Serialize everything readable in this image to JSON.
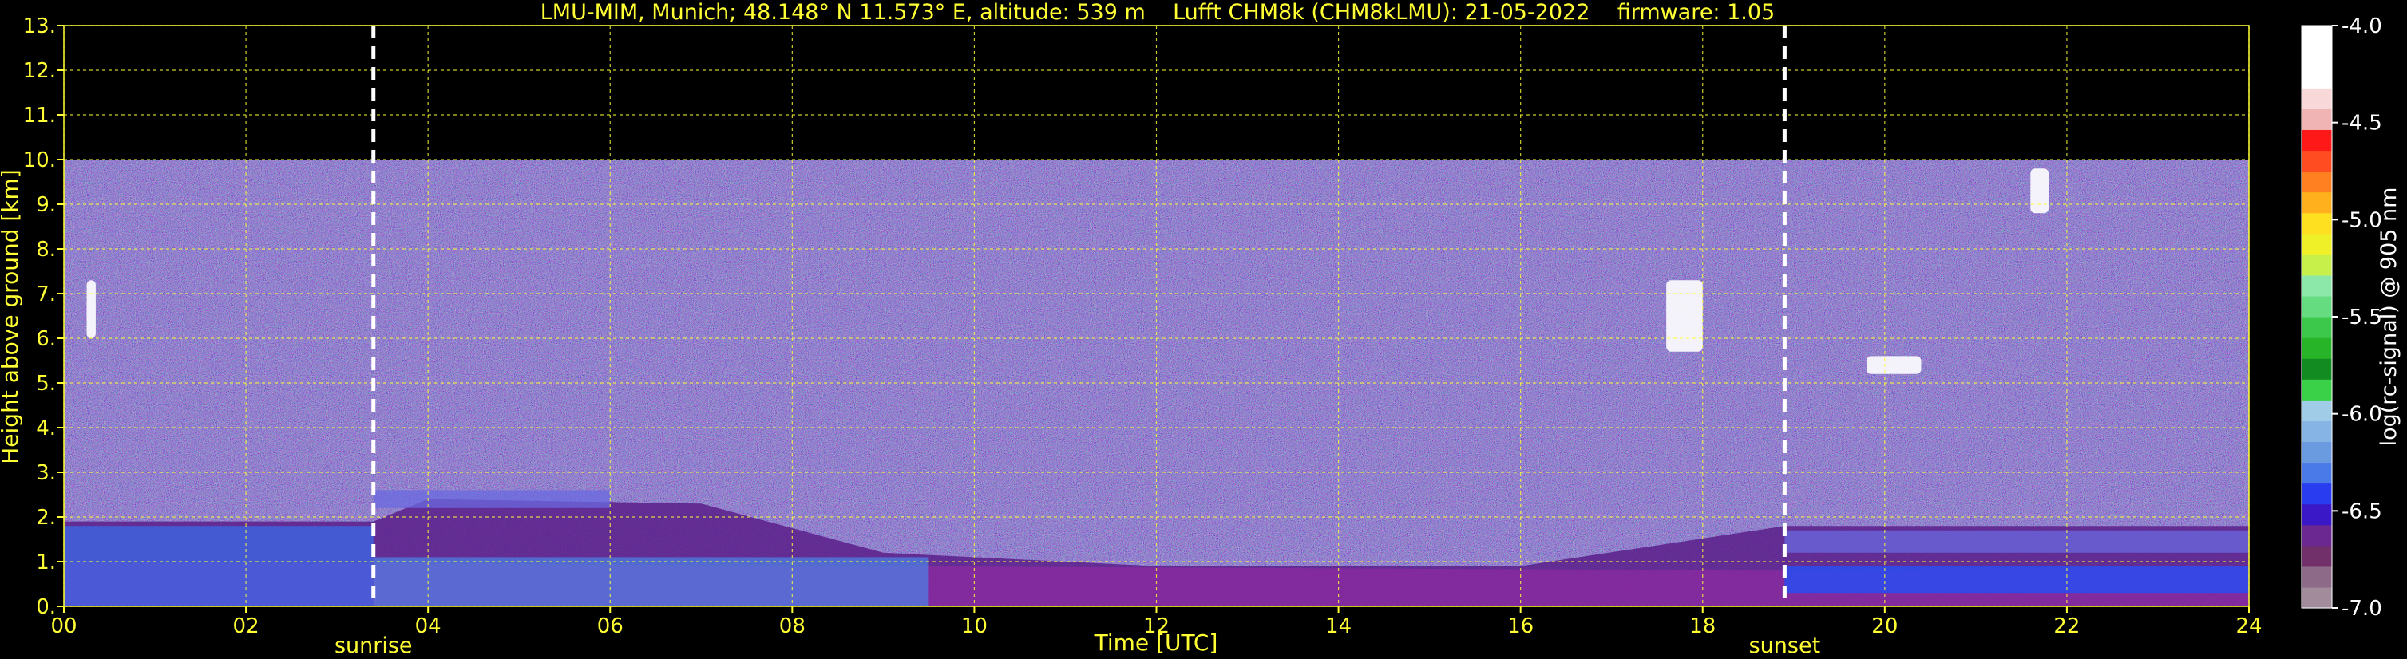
{
  "chart_data": {
    "type": "heatmap",
    "title": "LMU-MIM, Munich; 48.148° N 11.573° E, altitude: 539 m    Lufft CHM8k (CHM8kLMU): 21-05-2022    firmware: 1.05",
    "xlabel": "Time [UTC]",
    "ylabel": "Height above ground [km]",
    "xlim": [
      0,
      24
    ],
    "ylim": [
      0,
      13
    ],
    "xticks": [
      "00",
      "02",
      "04",
      "06",
      "08",
      "10",
      "12",
      "14",
      "16",
      "18",
      "20",
      "22",
      "24"
    ],
    "yticks": [
      "0.",
      "1.",
      "2.",
      "3.",
      "4.",
      "5.",
      "6.",
      "7.",
      "8.",
      "9.",
      "10.",
      "11.",
      "12.",
      "13."
    ],
    "grid": true,
    "data_max_height_km": 10,
    "events": [
      {
        "label": "sunrise",
        "time": 3.4
      },
      {
        "label": "sunset",
        "time": 18.9
      }
    ],
    "colorbar": {
      "label": "log(rc-signal) @ 905 nm",
      "range": [
        -7.0,
        -4.0
      ],
      "ticks": [
        "-4.0",
        "-4.5",
        "-5.0",
        "-5.5",
        "-6.0",
        "-6.5",
        "-7.0"
      ],
      "colors": [
        "#a28c9c",
        "#8c6a88",
        "#72306a",
        "#6a2890",
        "#3a18c8",
        "#2a3cf0",
        "#4a7ae8",
        "#6a9ae0",
        "#86b4e4",
        "#a0cce8",
        "#3ad048",
        "#128c20",
        "#28b428",
        "#3cc84a",
        "#66dc80",
        "#8ce8a8",
        "#c8f04a",
        "#f0f028",
        "#ffe020",
        "#ffb01c",
        "#ff8020",
        "#ff4c20",
        "#ff1818",
        "#f0b4b4",
        "#f8d8d8",
        "#ffffff",
        "#ffffff",
        "#ffffff"
      ]
    },
    "features": [
      {
        "name": "boundary layer",
        "t_start": 0,
        "t_end": 24,
        "h_bottom": 0,
        "h_top_profile": [
          [
            0,
            1.9
          ],
          [
            3.4,
            1.9
          ],
          [
            4,
            2.4
          ],
          [
            7,
            2.3
          ],
          [
            9,
            1.2
          ],
          [
            12,
            0.9
          ],
          [
            16,
            0.9
          ],
          [
            18.9,
            1.8
          ],
          [
            24,
            1.8
          ]
        ]
      },
      {
        "name": "residual aerosol layer",
        "t_start": 3.4,
        "t_end": 6.0,
        "h_bottom": 2.2,
        "h_top": 2.6
      },
      {
        "name": "night-time aerosol layer",
        "t_start": 18.9,
        "t_end": 24,
        "h_bottom": 1.2,
        "h_top": 1.7
      },
      {
        "name": "cloud",
        "t_start": 17.6,
        "t_end": 18.0,
        "h_bottom": 5.7,
        "h_top": 7.3
      },
      {
        "name": "cloud",
        "t_start": 19.8,
        "t_end": 20.4,
        "h_bottom": 5.2,
        "h_top": 5.6
      },
      {
        "name": "cloud",
        "t_start": 21.6,
        "t_end": 21.8,
        "h_bottom": 8.8,
        "h_top": 9.8
      },
      {
        "name": "cloud",
        "t_start": 0.25,
        "t_end": 0.35,
        "h_bottom": 6.0,
        "h_top": 7.3
      }
    ]
  }
}
